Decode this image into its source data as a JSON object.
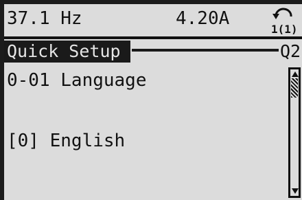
{
  "status": {
    "frequency": "37.1 Hz",
    "current": "4.20A",
    "setup_icon": "setup-1-1-icon",
    "setup_icon_text": "1(1)"
  },
  "menu": {
    "title": "Quick Setup",
    "code": "Q2"
  },
  "parameter": {
    "name": "0-01 Language",
    "value": "[0] English"
  },
  "scrollbar": {
    "position_fraction": 0.0
  }
}
